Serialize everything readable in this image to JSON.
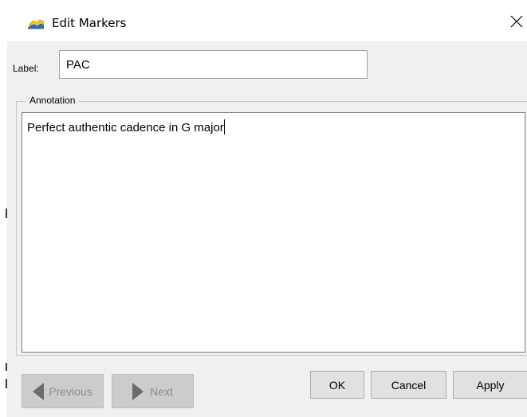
{
  "window": {
    "title": "Edit Markers",
    "close_symbol": "✕",
    "icon": "chart-area-icon"
  },
  "label_field": {
    "label": "Label:",
    "value": "PAC"
  },
  "annotation": {
    "legend": "Annotation",
    "text": "Perfect authentic cadence in G major"
  },
  "buttons": {
    "previous": "Previous",
    "next": "Next",
    "ok": "OK",
    "cancel": "Cancel",
    "apply": "Apply"
  },
  "colors": {
    "window_bg": "#f0f0f0",
    "titlebar_bg": "#ffffff",
    "button_bg": "#e1e1e1",
    "disabled_button_bg": "#cccccc",
    "icon_yellow": "#f2c12e",
    "icon_blue": "#2f6fb4"
  }
}
